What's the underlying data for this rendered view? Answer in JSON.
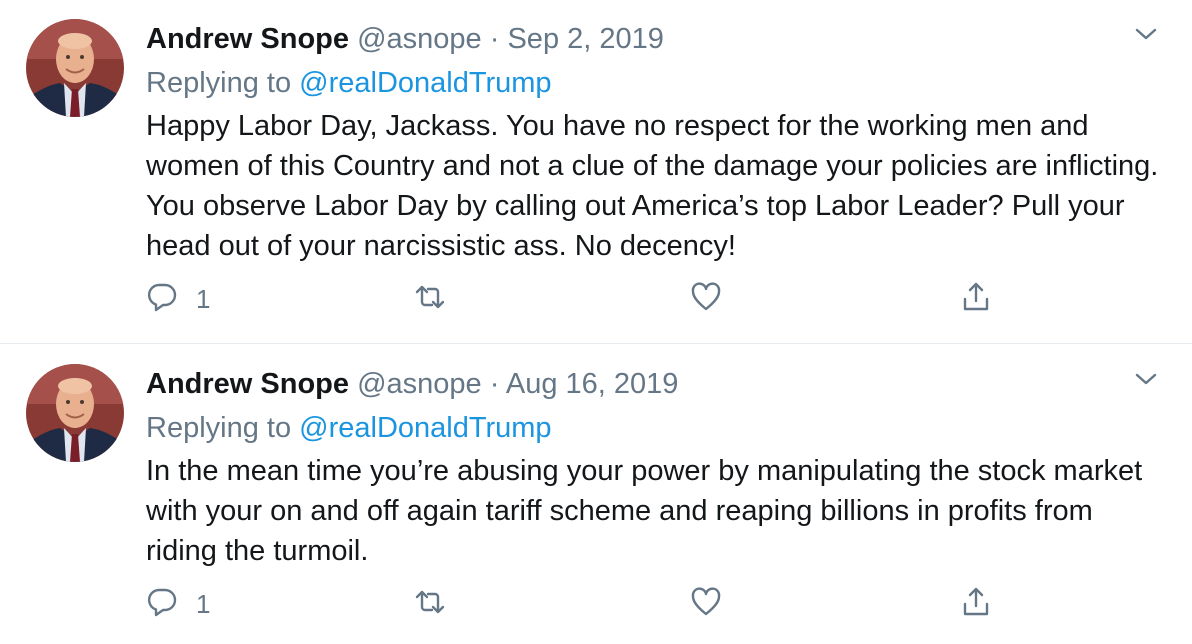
{
  "tweets": [
    {
      "author_name": "Andrew Snope",
      "handle": "@asnope",
      "separator": "·",
      "date": "Sep 2, 2019",
      "replying_prefix": "Replying to ",
      "replying_to": "@realDonaldTrump",
      "text": "Happy Labor Day, Jackass.  You have no respect for the working men and women of this Country and not a clue of the damage your policies are inflicting.  You observe Labor Day by calling out America’s top Labor Leader? Pull your head out of your narcissistic ass. No decency!",
      "reply_count": "1"
    },
    {
      "author_name": "Andrew Snope",
      "handle": "@asnope",
      "separator": "·",
      "date": "Aug 16, 2019",
      "replying_prefix": "Replying to ",
      "replying_to": "@realDonaldTrump",
      "text": "In the mean time you’re abusing your power by manipulating the stock market with your on and off again tariff scheme and reaping billions in profits from riding the turmoil.",
      "reply_count": "1"
    }
  ],
  "colors": {
    "text_primary": "#14171a",
    "text_secondary": "#657786",
    "link": "#1b95e0",
    "divider": "#e6ecf0"
  },
  "icons": [
    "avatar-photo",
    "chevron-down-icon",
    "reply-icon",
    "retweet-icon",
    "like-icon",
    "share-icon"
  ]
}
